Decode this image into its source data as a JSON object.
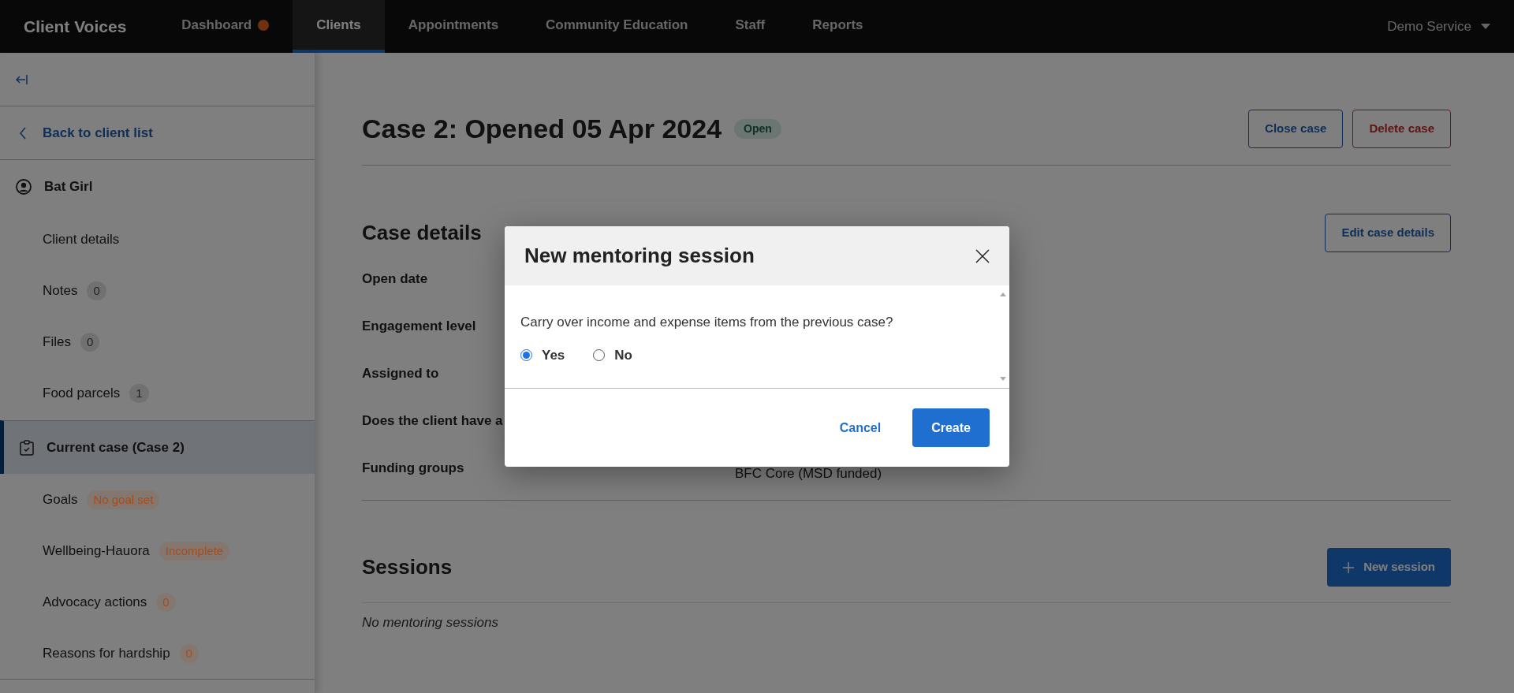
{
  "nav": {
    "brand": "Client Voices",
    "items": [
      {
        "label": "Dashboard",
        "selected": false,
        "dot": true
      },
      {
        "label": "Clients",
        "selected": true,
        "dot": false
      },
      {
        "label": "Appointments",
        "selected": false,
        "dot": false
      },
      {
        "label": "Community Education",
        "selected": false,
        "dot": false
      },
      {
        "label": "Staff",
        "selected": false,
        "dot": false
      },
      {
        "label": "Reports",
        "selected": false,
        "dot": false
      }
    ],
    "account": "Demo Service"
  },
  "sidebar": {
    "back_link": "Back to client list",
    "client": {
      "name": "Bat Girl",
      "items": [
        {
          "label": "Client details"
        },
        {
          "label": "Notes",
          "badge": {
            "text": "0",
            "color": "#222222"
          }
        },
        {
          "label": "Files",
          "badge": {
            "text": "0",
            "color": "#222222"
          }
        },
        {
          "label": "Food parcels",
          "badge": {
            "text": "1",
            "color": "#222222"
          }
        }
      ]
    },
    "case": {
      "label": "Current case (Case 2)",
      "selected": true,
      "items": [
        {
          "label": "Goals",
          "badge": {
            "text": "No goal set",
            "color": "#a34d1c"
          }
        },
        {
          "label": "Wellbeing-Hauora",
          "badge": {
            "text": "Incomplete",
            "color": "#a34d1c"
          }
        },
        {
          "label": "Advocacy actions",
          "badge": {
            "text": "0",
            "color": "#a34d1c"
          }
        },
        {
          "label": "Reasons for hardship",
          "badge": {
            "text": "0",
            "color": "#a34d1c"
          }
        }
      ]
    }
  },
  "main": {
    "title": "Case 2: Opened 05 Apr 2024",
    "status": "Open",
    "actions": [
      {
        "label": "Close case",
        "kind": "outline"
      },
      {
        "label": "Delete case",
        "kind": "danger"
      }
    ],
    "case_details": {
      "heading": "Case details",
      "edit_button": "Edit case details",
      "rows": [
        {
          "label": "Open date"
        },
        {
          "label": "Engagement level"
        },
        {
          "label": "Assigned to"
        },
        {
          "label": "Does the client have a"
        },
        {
          "label": "Funding groups",
          "value": "BFC Core (MSD funded)"
        }
      ]
    },
    "sessions": {
      "heading": "Sessions",
      "new_button": "New session",
      "empty": "No mentoring sessions"
    }
  },
  "modal": {
    "title": "New mentoring session",
    "question": "Carry over income and expense items from the previous case?",
    "options": [
      {
        "label": "Yes",
        "selected": true
      },
      {
        "label": "No",
        "selected": false
      }
    ],
    "cancel": "Cancel",
    "create": "Create"
  }
}
